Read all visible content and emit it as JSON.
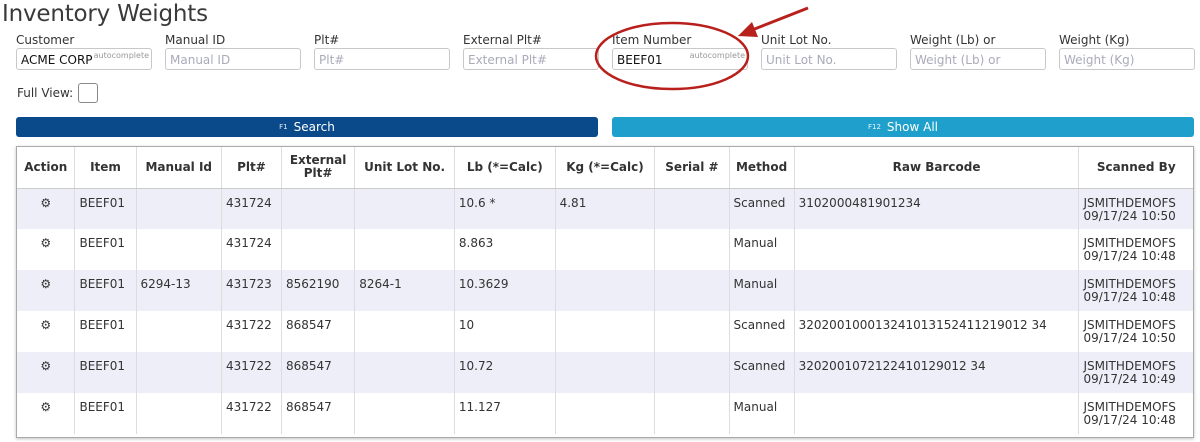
{
  "page": {
    "title": "Inventory Weights"
  },
  "filters": {
    "customer": {
      "label": "Customer",
      "value": "ACME CORP",
      "hint": "autocomplete"
    },
    "manual_id": {
      "label": "Manual ID",
      "placeholder": "Manual ID"
    },
    "plt": {
      "label": "Plt#",
      "placeholder": "Plt#"
    },
    "external_plt": {
      "label": "External Plt#",
      "placeholder": "External Plt#"
    },
    "item_number": {
      "label": "Item Number",
      "value": "BEEF01",
      "hint": "autocomplete"
    },
    "unit_lot": {
      "label": "Unit Lot No.",
      "placeholder": "Unit Lot No."
    },
    "weight_lb": {
      "label": "Weight (Lb) or",
      "placeholder": "Weight (Lb) or"
    },
    "weight_kg": {
      "label": "Weight (Kg)",
      "placeholder": "Weight (Kg)"
    },
    "full_view": {
      "label": "Full View:",
      "checked": false
    }
  },
  "buttons": {
    "search": {
      "key": "F1",
      "label": "Search"
    },
    "show_all": {
      "key": "F12",
      "label": "Show All"
    }
  },
  "table": {
    "headers": {
      "action": "Action",
      "item": "Item",
      "manual_id": "Manual Id",
      "plt": "Plt#",
      "external_plt_1": "External",
      "external_plt_2": "Plt#",
      "unit_lot": "Unit Lot No.",
      "lb": "Lb (*=Calc)",
      "kg": "Kg (*=Calc)",
      "serial": "Serial #",
      "method": "Method",
      "raw_barcode": "Raw Barcode",
      "scanned_by": "Scanned By"
    },
    "rows": [
      {
        "item": "BEEF01",
        "manual_id": "",
        "plt": "431724",
        "external_plt": "",
        "unit_lot": "",
        "lb": "10.6 *",
        "kg": "4.81",
        "serial": "",
        "method": "Scanned",
        "raw_barcode": "3102000481901234",
        "scanned_by": "JSMITHDEMOFS",
        "scanned_at": "09/17/24 10:50"
      },
      {
        "item": "BEEF01",
        "manual_id": "",
        "plt": "431724",
        "external_plt": "",
        "unit_lot": "",
        "lb": "8.863",
        "kg": "",
        "serial": "",
        "method": "Manual",
        "raw_barcode": "",
        "scanned_by": "JSMITHDEMOFS",
        "scanned_at": "09/17/24 10:48"
      },
      {
        "item": "BEEF01",
        "manual_id": "6294-13",
        "plt": "431723",
        "external_plt": "8562190",
        "unit_lot": "8264-1",
        "lb": "10.3629",
        "kg": "",
        "serial": "",
        "method": "Manual",
        "raw_barcode": "",
        "scanned_by": "JSMITHDEMOFS",
        "scanned_at": "09/17/24 10:48"
      },
      {
        "item": "BEEF01",
        "manual_id": "",
        "plt": "431722",
        "external_plt": "868547",
        "unit_lot": "",
        "lb": "10",
        "kg": "",
        "serial": "",
        "method": "Scanned",
        "raw_barcode": "320200100013241013152411219012 34",
        "scanned_by": "JSMITHDEMOFS",
        "scanned_at": "09/17/24 10:50"
      },
      {
        "item": "BEEF01",
        "manual_id": "",
        "plt": "431722",
        "external_plt": "868547",
        "unit_lot": "",
        "lb": "10.72",
        "kg": "",
        "serial": "",
        "method": "Scanned",
        "raw_barcode": "3202001072122410129012 34",
        "scanned_by": "JSMITHDEMOFS",
        "scanned_at": "09/17/24 10:49"
      },
      {
        "item": "BEEF01",
        "manual_id": "",
        "plt": "431722",
        "external_plt": "868547",
        "unit_lot": "",
        "lb": "11.127",
        "kg": "",
        "serial": "",
        "method": "Manual",
        "raw_barcode": "",
        "scanned_by": "JSMITHDEMOFS",
        "scanned_at": "09/17/24 10:48"
      }
    ]
  },
  "icons": {
    "action": "gears-icon"
  },
  "colors": {
    "search_button": "#0a4a8a",
    "show_all_button": "#1fa0cc",
    "row_alt": "#eeeef8"
  }
}
